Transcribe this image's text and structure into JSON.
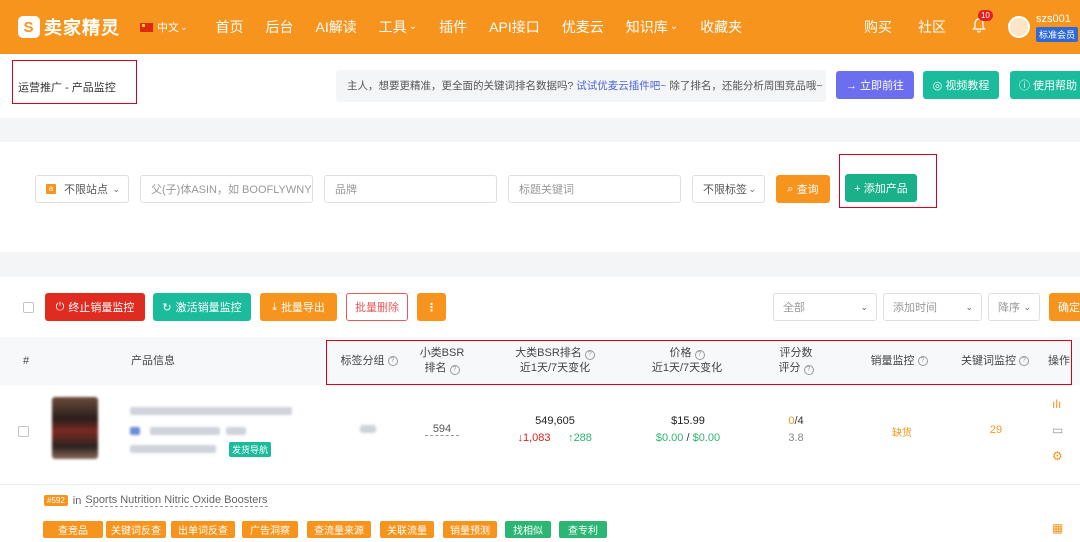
{
  "nav": {
    "logo_mark": "S",
    "logo": "卖家精灵",
    "lang": "中文",
    "menu": [
      "首页",
      "后台",
      "AI解读",
      "工具",
      "插件",
      "API接口",
      "优麦云",
      "知识库",
      "收藏夹"
    ],
    "buy": "购买",
    "community": "社区",
    "bell_count": "10",
    "username": "szs001",
    "member": "标准会员"
  },
  "breadcrumb": "运营推广 - 产品监控",
  "notice": {
    "text": "主人，想要更精准，更全面的关键词排名数据吗?",
    "link": "试试优麦云插件吧~",
    "tail": "除了排名，还能分析周围竞品哦~"
  },
  "top_buttons": {
    "go": "→ 立即前往",
    "video": "◎ 视频教程",
    "help": "ⓘ 使用帮助"
  },
  "filters": {
    "site": "不限站点",
    "site_icon": "a",
    "asin_placeholder": "父(子)体ASIN，如 BOOFLYWNYQ",
    "brand_placeholder": "品牌",
    "title_placeholder": "标题关键词",
    "tag": "不限标签",
    "query": "查询",
    "add": "+ 添加产品"
  },
  "actions": {
    "stop": "终止销量监控",
    "activate": "激活销量监控",
    "export": "批量导出",
    "delete": "批量删除",
    "more": "⋮",
    "sel_all": "全部",
    "sel_time": "添加时间",
    "sel_order": "降序",
    "confirm": "确定"
  },
  "table": {
    "headers": {
      "idx": "#",
      "product": "产品信息",
      "tag_group": "标签分组",
      "sub_bsr": [
        "小类BSR",
        "排名"
      ],
      "main_bsr": [
        "大类BSR排名",
        "近1天/7天变化"
      ],
      "price": [
        "价格",
        "近1天/7天变化"
      ],
      "rating": [
        "评分数",
        "评分"
      ],
      "sales_monitor": "销量监控",
      "kw_monitor": "关键词监控",
      "ops": "操作"
    },
    "row": {
      "nav_tag": "发货导航",
      "sub_bsr": "594",
      "main_bsr": "549,605",
      "bsr_1d": "↓1,083",
      "bsr_7d": "↑288",
      "price": "$15.99",
      "price_1d": "$0.00",
      "price_sep": "/",
      "price_7d": "$0.00",
      "rating_count": "0",
      "rating_total": "/4",
      "rating": "3.8",
      "sales": "缺货",
      "keywords": "29",
      "rank_badge": "#592",
      "category_prefix": "in",
      "category": "Sports Nutrition Nitric Oxide Boosters"
    },
    "tools": [
      "查竞品",
      "关键词反查",
      "出单词反查",
      "广告洞察",
      "查流量来源",
      "关联流量",
      "销量预测",
      "找相似",
      "查专利"
    ]
  },
  "colors": {
    "orange": "#f7941d",
    "teal": "#1abc9c",
    "red": "#d9001b",
    "purple": "#6c6ef0",
    "green": "#2bb673"
  }
}
